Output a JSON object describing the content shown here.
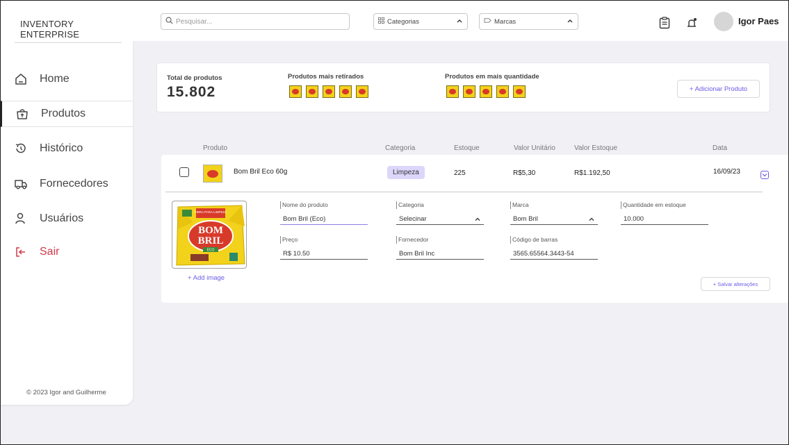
{
  "sidebar": {
    "brand": "INVENTORY ENTERPRISE",
    "items": [
      {
        "label": "Home",
        "icon": "home-icon"
      },
      {
        "label": "Produtos",
        "icon": "bag-icon"
      },
      {
        "label": "Histórico",
        "icon": "history-icon"
      },
      {
        "label": "Fornecedores",
        "icon": "truck-icon"
      },
      {
        "label": "Usuários",
        "icon": "user-icon"
      },
      {
        "label": "Sair",
        "icon": "logout-icon"
      }
    ],
    "footer": "© 2023 Igor and Guilherme"
  },
  "topbar": {
    "search_placeholder": "Pesquisar...",
    "categories_label": "Categorias",
    "brands_label": "Marcas",
    "username": "Igor Paes"
  },
  "summary": {
    "total_label": "Total de produtos",
    "total_value": "15.802",
    "most_withdrawn_label": "Produtos mais retirados",
    "most_quantity_label": "Produtos em mais quantidade",
    "add_button": "+ Adicionar Produto"
  },
  "table": {
    "headers": {
      "product": "Produto",
      "category": "Categoria",
      "stock": "Estoque",
      "unit_value": "Valor Unitário",
      "stock_value": "Valor Estoque",
      "date": "Data"
    },
    "row": {
      "name": "Bom Bril Eco 60g",
      "category": "Limpeza",
      "stock": "225",
      "unit_value": "R$5,30",
      "stock_value": "R$1.192,50",
      "date": "16/09/23"
    }
  },
  "detail": {
    "add_image": "+ Add image",
    "fields": {
      "name_label": "Nome do produto",
      "name_value": "Bom Bril (Eco)",
      "category_label": "Categoria",
      "category_value": "Selecinar",
      "brand_label": "Marca",
      "brand_value": "Bom Bril",
      "qty_label": "Quantidade em estoque",
      "qty_value": "10.000",
      "price_label": "Preço",
      "price_value": "R$ 10.50",
      "supplier_label": "Fornecedor",
      "supplier_value": "Bom Bril Inc",
      "barcode_label": "Código de barras",
      "barcode_value": "3565.65564.3443-54"
    },
    "package": {
      "top_text": "FIBRA PARA LIMPEZA",
      "brand_line1": "BOM",
      "brand_line2": "BRIL",
      "sub": "ECO"
    },
    "save_button": "+ Salvar alterações"
  },
  "colors": {
    "accent": "#6c5ce7",
    "danger": "#d0394a",
    "badge": "#ddd6fb"
  }
}
